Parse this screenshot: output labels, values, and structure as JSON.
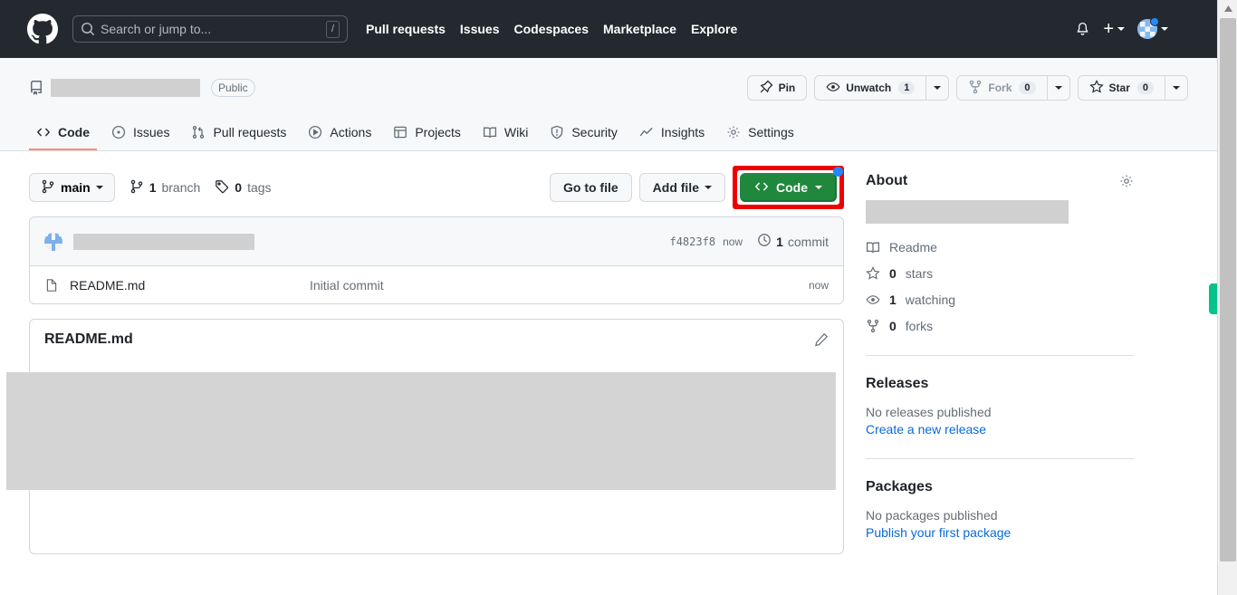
{
  "header": {
    "logo_icon": "github-mark-icon",
    "search": {
      "placeholder": "Search or jump to...",
      "shortcut_key": "/",
      "icon": "search-icon"
    },
    "nav": [
      {
        "label": "Pull requests"
      },
      {
        "label": "Issues"
      },
      {
        "label": "Codespaces"
      },
      {
        "label": "Marketplace"
      },
      {
        "label": "Explore"
      }
    ],
    "notifications_icon": "bell-icon",
    "create_new_label": "+",
    "create_new_icon": "plus-icon",
    "avatar_icon": "user-avatar",
    "avatar_status_icon": "status-dot-icon"
  },
  "repo": {
    "icon": "repo-icon",
    "name": "",
    "visibility": "Public",
    "actions": {
      "pin_label": "Pin",
      "pin_icon": "pin-icon",
      "watch_label": "Unwatch",
      "watch_count": "1",
      "watch_icon": "eye-icon",
      "fork_label": "Fork",
      "fork_count": "0",
      "fork_icon": "fork-icon",
      "star_label": "Star",
      "star_count": "0",
      "star_icon": "star-icon"
    },
    "tabs": [
      {
        "label": "Code",
        "icon": "code-icon",
        "active": true
      },
      {
        "label": "Issues",
        "icon": "issue-opened-icon",
        "active": false
      },
      {
        "label": "Pull requests",
        "icon": "git-pull-request-icon",
        "active": false
      },
      {
        "label": "Actions",
        "icon": "play-icon",
        "active": false
      },
      {
        "label": "Projects",
        "icon": "table-icon",
        "active": false
      },
      {
        "label": "Wiki",
        "icon": "book-icon",
        "active": false
      },
      {
        "label": "Security",
        "icon": "shield-icon",
        "active": false
      },
      {
        "label": "Insights",
        "icon": "graph-icon",
        "active": false
      },
      {
        "label": "Settings",
        "icon": "gear-icon",
        "active": false
      }
    ]
  },
  "toolbar": {
    "branch_label": "main",
    "branch_icon": "git-branch-icon",
    "branches_count": "1",
    "branches_label": "branch",
    "tags_count": "0",
    "tags_label": "tags",
    "tag_icon": "tag-icon",
    "go_to_file_label": "Go to file",
    "add_file_label": "Add file",
    "code_label": "Code",
    "code_icon": "code-icon",
    "highlight_color": "#ee0000",
    "code_button_color": "#1f883d",
    "new_badge_color": "#2188ff"
  },
  "commit": {
    "author_avatar_icon": "identicon-avatar",
    "message": "",
    "sha": "f4823f8",
    "time": "now",
    "history_icon": "history-icon",
    "commits_count": "1",
    "commits_label": "commit"
  },
  "files": [
    {
      "icon": "file-icon",
      "name": "README.md",
      "message": "Initial commit",
      "time": "now"
    }
  ],
  "readme": {
    "title": "README.md",
    "edit_icon": "pencil-icon"
  },
  "sidebar": {
    "about": {
      "title": "About",
      "settings_icon": "gear-icon",
      "description": "",
      "items": [
        {
          "icon": "book-icon",
          "label": "Readme",
          "count": ""
        },
        {
          "icon": "star-icon",
          "count": "0",
          "label": "stars"
        },
        {
          "icon": "eye-icon",
          "count": "1",
          "label": "watching"
        },
        {
          "icon": "fork-icon",
          "count": "0",
          "label": "forks"
        }
      ]
    },
    "releases": {
      "title": "Releases",
      "empty_text": "No releases published",
      "action_link": "Create a new release"
    },
    "packages": {
      "title": "Packages",
      "empty_text": "No packages published",
      "action_link": "Publish your first package"
    }
  },
  "browser": {
    "scrollbar_icon": "scroll-up-arrow-icon",
    "side_widget_icon": "side-widget-tab",
    "side_widget_color": "#00c48c"
  }
}
